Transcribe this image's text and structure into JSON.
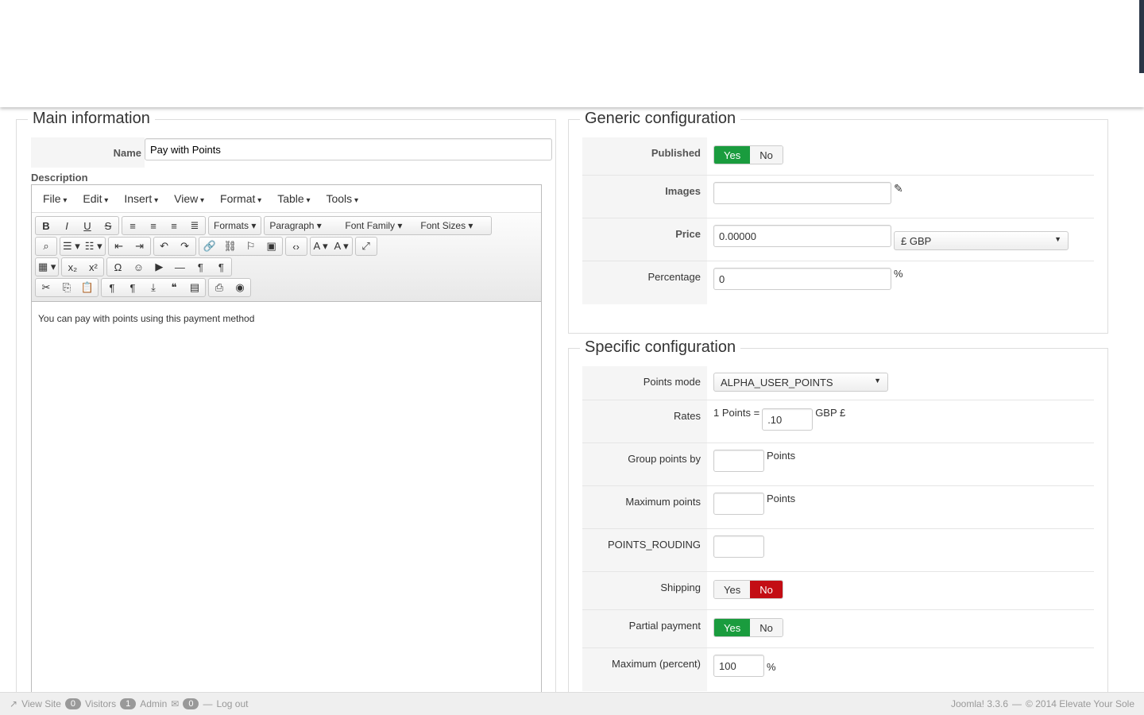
{
  "main": {
    "legend": "Main information",
    "name_label": "Name",
    "name_value": "Pay with Points",
    "description_label": "Description",
    "editor": {
      "menus": [
        "File",
        "Edit",
        "Insert",
        "View",
        "Format",
        "Table",
        "Tools"
      ],
      "toolbar_rows": [
        [
          [
            "bold-icon",
            "B"
          ],
          [
            "italic-icon",
            "I"
          ],
          [
            "underline-icon",
            "U"
          ],
          [
            "strikethrough-icon",
            "S"
          ],
          "|",
          [
            "align-left-icon",
            "≡"
          ],
          [
            "align-center-icon",
            "≡"
          ],
          [
            "align-right-icon",
            "≡"
          ],
          [
            "justify-icon",
            "≣"
          ],
          "|",
          [
            "formats-dropdown",
            "Formats ▾"
          ],
          "|",
          [
            "paragraph-dropdown",
            "Paragraph ▾"
          ],
          [
            "font-family-dropdown",
            "Font Family ▾"
          ],
          [
            "font-sizes-dropdown",
            "Font Sizes ▾"
          ]
        ],
        [
          [
            "find-icon",
            "⌕"
          ],
          "|",
          [
            "bullet-list-icon",
            "☰ ▾"
          ],
          [
            "numbered-list-icon",
            "☷ ▾"
          ],
          "|",
          [
            "outdent-icon",
            "⇤"
          ],
          [
            "indent-icon",
            "⇥"
          ],
          "|",
          [
            "undo-icon",
            "↶"
          ],
          [
            "redo-icon",
            "↷"
          ],
          "|",
          [
            "link-icon",
            "🔗"
          ],
          [
            "unlink-icon",
            "⛓"
          ],
          [
            "bookmark-icon",
            "⚐"
          ],
          [
            "image-icon",
            "▣"
          ],
          "|",
          [
            "code-icon",
            "‹›"
          ],
          "|",
          [
            "text-color-icon",
            "A ▾"
          ],
          [
            "background-color-icon",
            "A ▾"
          ],
          "|",
          [
            "fullscreen-icon",
            "⤢"
          ]
        ],
        [
          [
            "table-icon",
            "▦ ▾"
          ],
          "|",
          [
            "subscript-icon",
            "x₂"
          ],
          [
            "superscript-icon",
            "x²"
          ],
          "|",
          [
            "special-char-icon",
            "Ω"
          ],
          [
            "emoticon-icon",
            "☺"
          ],
          [
            "media-icon",
            "▶"
          ],
          [
            "horizontal-rule-icon",
            "—"
          ],
          [
            "ltr-icon",
            "¶"
          ],
          [
            "rtl-icon",
            "¶"
          ]
        ],
        [
          [
            "cut-icon",
            "✂"
          ],
          [
            "copy-icon",
            "⎘"
          ],
          [
            "paste-icon",
            "📋"
          ],
          "|",
          [
            "paste-text-icon",
            "¶"
          ],
          [
            "visual-chars-icon",
            "¶"
          ],
          [
            "insert-icon",
            "⤓"
          ],
          [
            "blockquote-icon",
            "❝"
          ],
          [
            "template-icon",
            "▤"
          ],
          "|",
          [
            "print-icon",
            "⎙"
          ],
          [
            "preview-icon",
            "◉"
          ]
        ]
      ],
      "content": "You can pay with points using this payment method"
    }
  },
  "generic": {
    "legend": "Generic configuration",
    "published_label": "Published",
    "images_label": "Images",
    "price_label": "Price",
    "price_value": "0.00000",
    "currency": "£ GBP",
    "percentage_label": "Percentage",
    "percentage_value": "0",
    "percent_sign": "%"
  },
  "specific": {
    "legend": "Specific configuration",
    "points_mode_label": "Points mode",
    "points_mode_value": "ALPHA_USER_POINTS",
    "rates_label": "Rates",
    "rates_prefix": "1 Points =",
    "rates_value": ".10",
    "rates_suffix": "GBP £",
    "group_label": "Group points by",
    "group_suffix": "Points",
    "max_points_label": "Maximum points",
    "max_points_suffix": "Points",
    "rouding_label": "POINTS_ROUDING",
    "shipping_label": "Shipping",
    "partial_label": "Partial payment",
    "max_percent_label": "Maximum (percent)",
    "max_percent_value": "100",
    "percent_sign": "%"
  },
  "toggle": {
    "yes": "Yes",
    "no": "No"
  },
  "footer": {
    "view_site": "View Site",
    "visitors_count": "0",
    "visitors": "Visitors",
    "admin_count": "1",
    "admin": "Admin",
    "messages_count": "0",
    "logout": "Log out",
    "version": "Joomla! 3.3.6",
    "sep": "—",
    "copyright": "© 2014 Elevate Your Sole"
  }
}
